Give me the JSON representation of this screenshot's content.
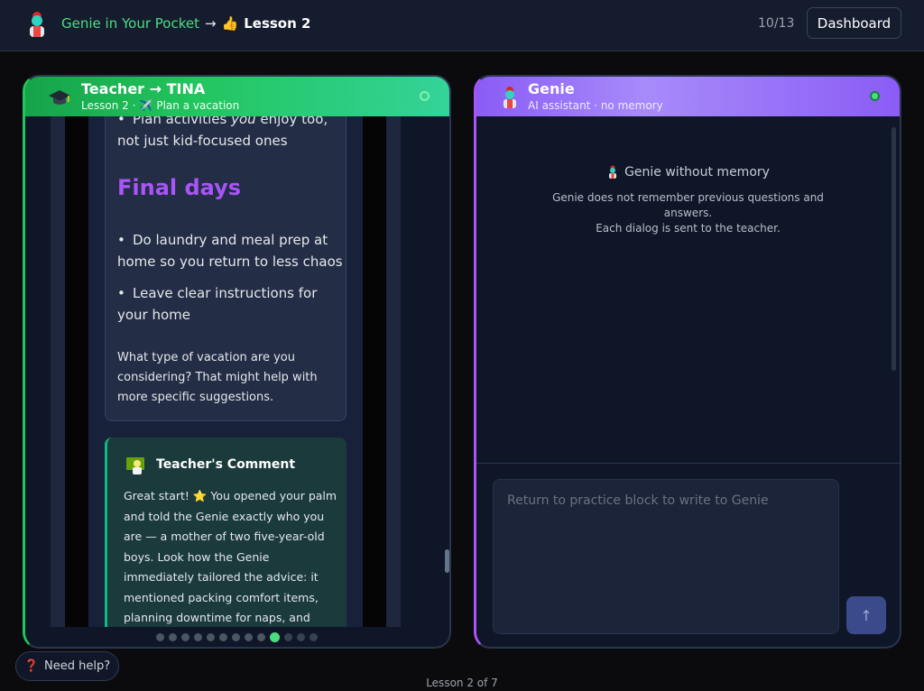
{
  "topbar": {
    "app_name": "Genie in Your Pocket",
    "arrow": "→",
    "lesson_emoji": "👍",
    "lesson_label": "Lesson 2",
    "progress": "10/13",
    "dashboard_label": "Dashboard"
  },
  "teacher_panel": {
    "title": "Teacher → TINA",
    "subtitle_prefix": "Lesson 2 ·",
    "subtitle_emoji": "✈️",
    "subtitle_text": "Plan a vacation",
    "card": {
      "bullet_top_a": "Plan activities ",
      "bullet_top_em": "you",
      "bullet_top_b": " enjoy too,",
      "bullet_top_line2": "not just kid-focused ones",
      "final_heading": "Final days",
      "bullet_2_line1": "Do laundry and meal prep at",
      "bullet_2_line2": "home so you return to less chaos",
      "bullet_3_line1": "Leave clear instructions for",
      "bullet_3_line2": "your home",
      "question": "What type of vacation are you considering? That might help with more specific suggestions."
    },
    "comment": {
      "title": "Teacher's Comment",
      "text_a": "Great start! ",
      "star": "⭐",
      "text_b": " You opened your palm and told the Genie exactly who you are — a mother of two five-year-old boys. Look how the Genie immediately tailored the advice: it mentioned packing comfort items, planning downtime for naps, and"
    },
    "pagination": {
      "total": 13,
      "current": 10
    }
  },
  "genie_panel": {
    "title": "Genie",
    "subtitle": "AI assistant · no memory",
    "empty_heading": "Genie without memory",
    "empty_desc": "Genie does not remember previous questions and answers.",
    "empty_desc2": "Each dialog is sent to the teacher.",
    "input_placeholder": "Return to practice block to write to Genie",
    "send_icon": "↑"
  },
  "help": {
    "icon": "❓",
    "label": "Need help?"
  },
  "footer": {
    "lesson_progress": "Lesson 2 of 7"
  },
  "colors": {
    "accent_green": "#22c55e",
    "accent_purple": "#a855f7",
    "app_name_green": "#4ade80",
    "background": "#0b0b0d",
    "panel_bg": "#0f1628"
  }
}
